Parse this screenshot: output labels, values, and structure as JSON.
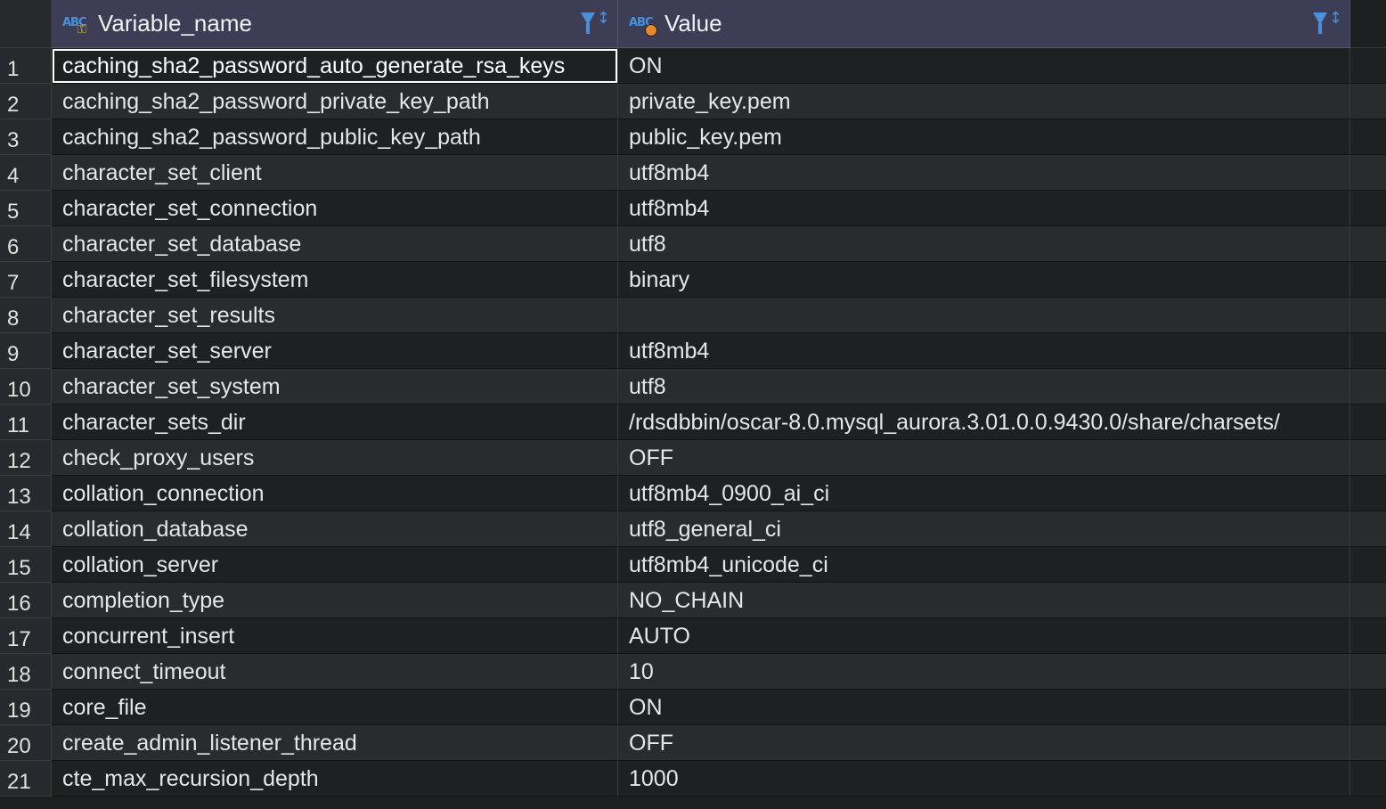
{
  "header": {
    "col1_label": "Variable_name",
    "col2_label": "Value",
    "col1_type_icon": "abc-key-icon",
    "col2_type_icon": "abc-dot-icon",
    "sort_icon": "filter-sort-icon",
    "accent_color": "#4a90d9"
  },
  "rows": [
    {
      "num": "1",
      "name": "caching_sha2_password_auto_generate_rsa_keys",
      "value": "ON"
    },
    {
      "num": "2",
      "name": "caching_sha2_password_private_key_path",
      "value": "private_key.pem"
    },
    {
      "num": "3",
      "name": "caching_sha2_password_public_key_path",
      "value": "public_key.pem"
    },
    {
      "num": "4",
      "name": "character_set_client",
      "value": "utf8mb4"
    },
    {
      "num": "5",
      "name": "character_set_connection",
      "value": "utf8mb4"
    },
    {
      "num": "6",
      "name": "character_set_database",
      "value": "utf8"
    },
    {
      "num": "7",
      "name": "character_set_filesystem",
      "value": "binary"
    },
    {
      "num": "8",
      "name": "character_set_results",
      "value": ""
    },
    {
      "num": "9",
      "name": "character_set_server",
      "value": "utf8mb4"
    },
    {
      "num": "10",
      "name": "character_set_system",
      "value": "utf8"
    },
    {
      "num": "11",
      "name": "character_sets_dir",
      "value": "/rdsdbbin/oscar-8.0.mysql_aurora.3.01.0.0.9430.0/share/charsets/"
    },
    {
      "num": "12",
      "name": "check_proxy_users",
      "value": "OFF"
    },
    {
      "num": "13",
      "name": "collation_connection",
      "value": "utf8mb4_0900_ai_ci"
    },
    {
      "num": "14",
      "name": "collation_database",
      "value": "utf8_general_ci"
    },
    {
      "num": "15",
      "name": "collation_server",
      "value": "utf8mb4_unicode_ci"
    },
    {
      "num": "16",
      "name": "completion_type",
      "value": "NO_CHAIN"
    },
    {
      "num": "17",
      "name": "concurrent_insert",
      "value": "AUTO"
    },
    {
      "num": "18",
      "name": "connect_timeout",
      "value": "10"
    },
    {
      "num": "19",
      "name": "core_file",
      "value": "ON"
    },
    {
      "num": "20",
      "name": "create_admin_listener_thread",
      "value": "OFF"
    },
    {
      "num": "21",
      "name": "cte_max_recursion_depth",
      "value": "1000"
    }
  ]
}
